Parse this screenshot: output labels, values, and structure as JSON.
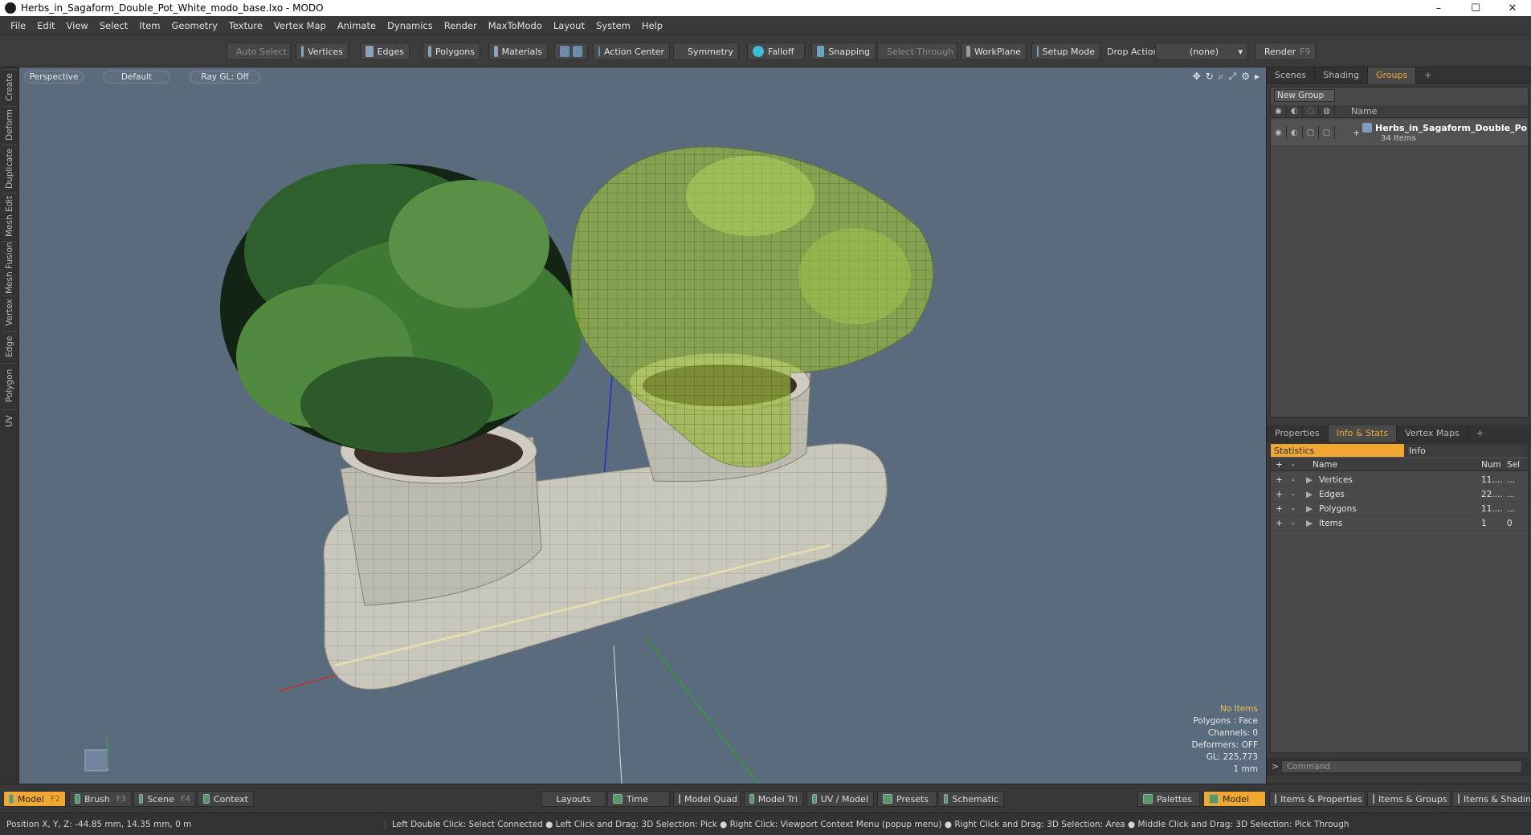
{
  "window": {
    "title": "Herbs_in_Sagaform_Double_Pot_White_modo_base.lxo - MODO",
    "minimize": "–",
    "maximize": "☐",
    "close": "✕"
  },
  "menu": [
    "File",
    "Edit",
    "View",
    "Select",
    "Item",
    "Geometry",
    "Texture",
    "Vertex Map",
    "Animate",
    "Dynamics",
    "Render",
    "MaxToModo",
    "Layout",
    "System",
    "Help"
  ],
  "toolbar": {
    "auto_select": "Auto Select",
    "vertices": "Vertices",
    "edges": "Edges",
    "polygons": "Polygons",
    "materials": "Materials",
    "action_center": "Action Center",
    "symmetry": "Symmetry",
    "falloff": "Falloff",
    "snapping": "Snapping",
    "select_through": "Select Through",
    "workplane": "WorkPlane",
    "setup_mode": "Setup Mode",
    "drop_action_label": "Drop Action",
    "drop_action_value": "(none)",
    "render": "Render",
    "render_key": "F9"
  },
  "left_tabs": [
    "Create",
    "Deform",
    "Duplicate",
    "Mesh Edit",
    "Mesh Fusion",
    "Vertex",
    "Edge",
    "Polygon",
    "UV"
  ],
  "viewport": {
    "view": "Perspective",
    "shading": "Default",
    "raygl": "Ray GL: Off",
    "info": {
      "no_items": "No Items",
      "polygons": "Polygons : Face",
      "channels": "Channels: 0",
      "deformers": "Deformers: OFF",
      "gl": "GL: 225,773",
      "unit": "1 mm"
    }
  },
  "top_panel": {
    "tabs": [
      "Scenes",
      "Shading",
      "Groups"
    ],
    "active_tab": "Groups",
    "new_group": "New Group",
    "col_name": "Name",
    "group_name": "Herbs_in_Sagaform_Double_Po ...",
    "group_count": "34 Items"
  },
  "bottom_panel": {
    "tabs": [
      "Properties",
      "Info & Stats",
      "Vertex Maps"
    ],
    "active_tab": "Info & Stats",
    "stats_tab": "Statistics",
    "info_tab": "Info",
    "headers": {
      "plus": "+",
      "minus": "-",
      "name": "Name",
      "num": "Num",
      "sel": "Sel"
    },
    "rows": [
      {
        "name": "Vertices",
        "num": "11....",
        "sel": "..."
      },
      {
        "name": "Edges",
        "num": "22....",
        "sel": "..."
      },
      {
        "name": "Polygons",
        "num": "11....",
        "sel": "..."
      },
      {
        "name": "Items",
        "num": "1",
        "sel": "0"
      }
    ],
    "command_placeholder": "Command",
    "command_prompt": ">"
  },
  "bottom_bar": {
    "model": "Model",
    "model_key": "F2",
    "brush": "Brush",
    "brush_key": "F3",
    "scene": "Scene",
    "scene_key": "F4",
    "context": "Context",
    "layouts": "Layouts",
    "time": "Time",
    "model_quad": "Model Quad",
    "model_tri": "Model Tri",
    "uv_model": "UV / Model",
    "presets": "Presets",
    "schematic": "Schematic",
    "palettes": "Palettes",
    "model_right": "Model",
    "items_properties": "Items & Properties",
    "items_groups": "Items & Groups",
    "items_shading": "Items & Shading"
  },
  "status": {
    "position": "Position X, Y, Z:   -44.85 mm, 14.35 mm, 0 m",
    "hint": "Left Double Click: Select Connected ● Left Click and Drag: 3D Selection: Pick ● Right Click: Viewport Context Menu (popup menu) ● Right Click and Drag: 3D Selection: Area ● Middle Click and Drag: 3D Selection: Pick Through"
  },
  "colors": {
    "accent": "#f0a830",
    "viewport_bg": "#5a6b7d"
  }
}
